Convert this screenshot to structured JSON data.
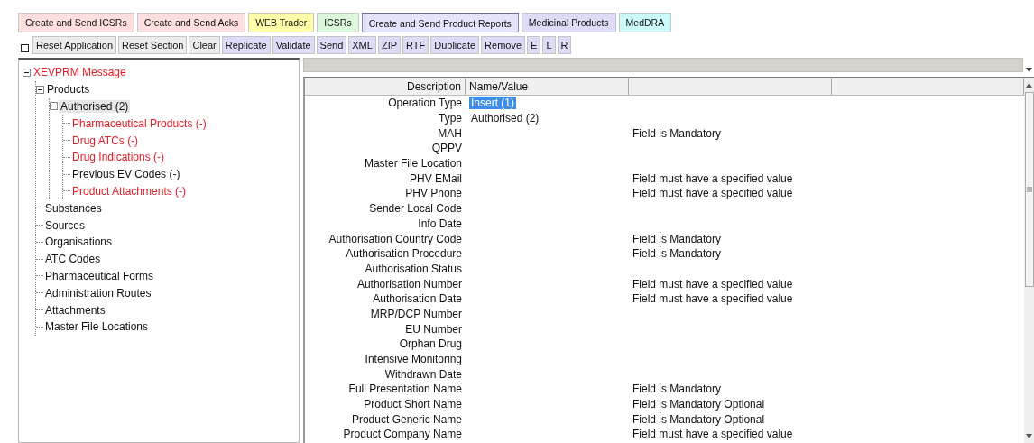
{
  "tabs": [
    {
      "label": "Create and Send ICSRs",
      "color": "#ffdede",
      "selected": false
    },
    {
      "label": "Create and Send Acks",
      "color": "#ffdede",
      "selected": false
    },
    {
      "label": "WEB Trader",
      "color": "#ffffaa",
      "selected": false
    },
    {
      "label": "ICSRs",
      "color": "#dcf8dc",
      "selected": false
    },
    {
      "label": "Create and Send Product Reports",
      "color": "#e4e4fa",
      "selected": true
    },
    {
      "label": "Medicinal Products",
      "color": "#dcdcf6",
      "selected": false
    },
    {
      "label": "MedDRA",
      "color": "#ccfaf8",
      "selected": false
    }
  ],
  "toolbar": {
    "checkbox": {
      "checked": false
    },
    "buttons": [
      {
        "label": "Reset Application",
        "color": "#ececec"
      },
      {
        "label": "Reset Section",
        "color": "#ececec"
      },
      {
        "label": "Clear",
        "color": "#ececec"
      },
      {
        "label": "Replicate",
        "color": "#dcdcf8"
      },
      {
        "label": "Validate",
        "color": "#dcdcf8"
      },
      {
        "label": "Send",
        "color": "#dcdcf8"
      },
      {
        "label": "XML",
        "color": "#dcdcf8"
      },
      {
        "label": "ZIP",
        "color": "#dcdcf8"
      },
      {
        "label": "RTF",
        "color": "#dcdcf8"
      },
      {
        "label": "Duplicate",
        "color": "#dcdcf8"
      },
      {
        "label": "Remove",
        "color": "#dcdcf8"
      },
      {
        "label": "E",
        "color": "#dcdcf8"
      },
      {
        "label": "L",
        "color": "#dcdcf8"
      },
      {
        "label": "R",
        "color": "#dcdcf8"
      }
    ]
  },
  "tree": [
    {
      "label": "XEVPRM Message",
      "error": true,
      "selected": false,
      "expanded": true,
      "children": [
        {
          "label": "Products",
          "error": false,
          "selected": false,
          "expanded": true,
          "children": [
            {
              "label": "Authorised (2)",
              "error": false,
              "selected": true,
              "expanded": true,
              "children": [
                {
                  "label": "Pharmaceutical Products (-)",
                  "error": true,
                  "selected": false
                },
                {
                  "label": "Drug ATCs (-)",
                  "error": true,
                  "selected": false
                },
                {
                  "label": "Drug Indications (-)",
                  "error": true,
                  "selected": false
                },
                {
                  "label": "Previous EV Codes (-)",
                  "error": false,
                  "selected": false
                },
                {
                  "label": "Product Attachments (-)",
                  "error": true,
                  "selected": false
                }
              ]
            }
          ]
        },
        {
          "label": "Substances",
          "error": false,
          "selected": false
        },
        {
          "label": "Sources",
          "error": false,
          "selected": false
        },
        {
          "label": "Organisations",
          "error": false,
          "selected": false
        },
        {
          "label": "ATC Codes",
          "error": false,
          "selected": false
        },
        {
          "label": "Pharmaceutical Forms",
          "error": false,
          "selected": false
        },
        {
          "label": "Administration Routes",
          "error": false,
          "selected": false
        },
        {
          "label": "Attachments",
          "error": false,
          "selected": false
        },
        {
          "label": "Master File Locations",
          "error": false,
          "selected": false
        }
      ]
    }
  ],
  "table": {
    "columns": [
      "Description",
      "Name/Value"
    ],
    "rows": [
      {
        "description": "Operation Type",
        "value": "Insert (1)",
        "selected": true
      },
      {
        "description": "Type",
        "value": "Authorised (2)",
        "selected": false
      },
      {
        "description": "MAH",
        "message": "Field is Mandatory",
        "selected": false
      },
      {
        "description": "QPPV",
        "selected": false
      },
      {
        "description": "Master File Location",
        "selected": false
      },
      {
        "description": "PHV EMail",
        "message": "Field must have a specified value",
        "selected": false
      },
      {
        "description": "PHV Phone",
        "message": "Field must have a specified value",
        "selected": false
      },
      {
        "description": "Sender Local Code",
        "selected": false
      },
      {
        "description": "Info Date",
        "selected": false
      },
      {
        "description": "Authorisation Country Code",
        "message": "Field is Mandatory",
        "selected": false
      },
      {
        "description": "Authorisation Procedure",
        "message": "Field is Mandatory",
        "selected": false
      },
      {
        "description": "Authorisation Status",
        "selected": false
      },
      {
        "description": "Authorisation Number",
        "message": "Field must have a specified value",
        "selected": false
      },
      {
        "description": "Authorisation Date",
        "message": "Field must have a specified value",
        "selected": false
      },
      {
        "description": "MRP/DCP Number",
        "selected": false
      },
      {
        "description": "EU Number",
        "selected": false
      },
      {
        "description": "Orphan Drug",
        "selected": false
      },
      {
        "description": "Intensive Monitoring",
        "selected": false
      },
      {
        "description": "Withdrawn Date",
        "selected": false
      },
      {
        "description": "Full Presentation Name",
        "message": "Field is Mandatory",
        "selected": false
      },
      {
        "description": "Product Short Name",
        "message": "Field is Mandatory Optional",
        "selected": false
      },
      {
        "description": "Product Generic Name",
        "message": "Field is Mandatory Optional",
        "selected": false
      },
      {
        "description": "Product Company Name",
        "message": "Field must have a specified value",
        "selected": false
      }
    ]
  }
}
